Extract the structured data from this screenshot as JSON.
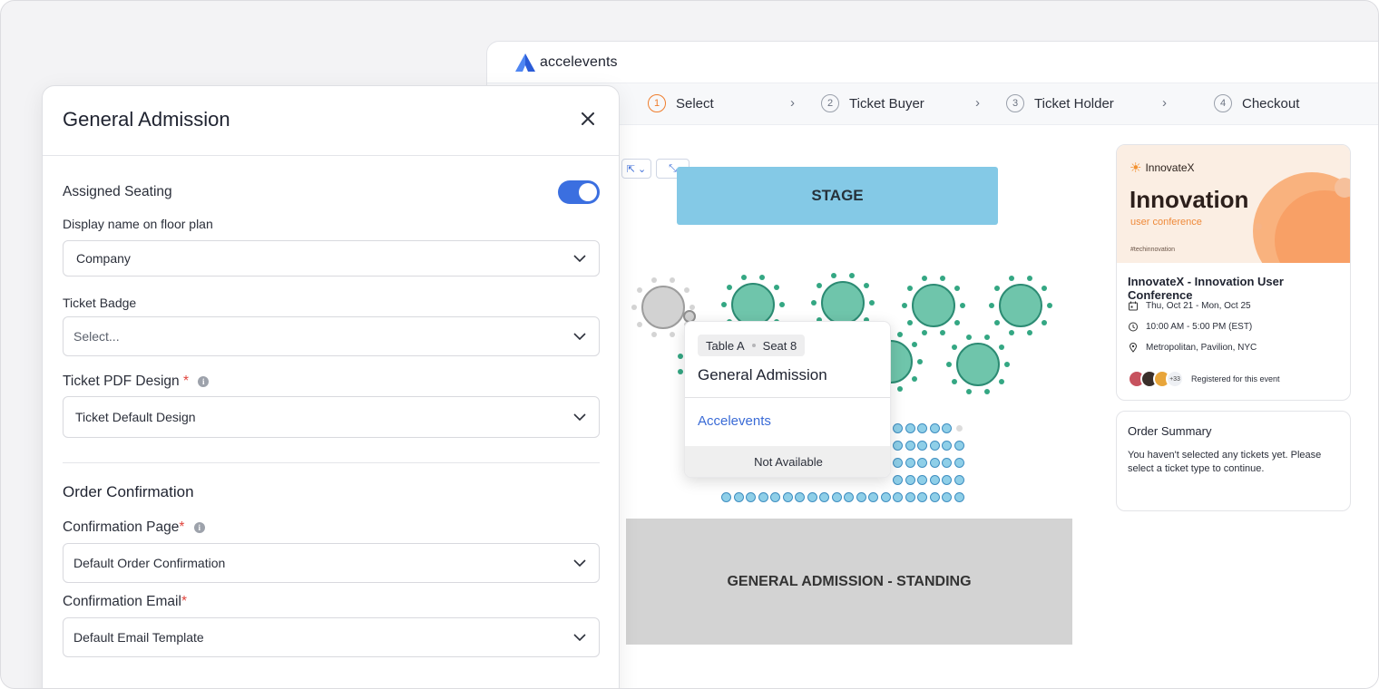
{
  "app": {
    "brand": "accelevents",
    "steps": [
      {
        "num": "1",
        "label": "Select"
      },
      {
        "num": "2",
        "label": "Ticket Buyer"
      },
      {
        "num": "3",
        "label": "Ticket Holder"
      },
      {
        "num": "4",
        "label": "Checkout"
      }
    ],
    "step_arrow": "›"
  },
  "floor_plan": {
    "stage_label": "STAGE",
    "standing_label": "GENERAL ADMISSION - STANDING",
    "tool_select": "⇱ ⌄",
    "tool_expand": "⤡"
  },
  "popup": {
    "table": "Table A",
    "seat": "Seat 8",
    "title": "General Admission",
    "company": "Accelevents",
    "status": "Not Available"
  },
  "event": {
    "brand": "InnovateX",
    "banner_title": "Innovation",
    "banner_subtitle": "user conference",
    "hashtag": "#techinnovation",
    "title": "InnovateX - Innovation User Conference",
    "dates": "Thu, Oct 21 - Mon, Oct 25",
    "time": "10:00 AM - 5:00 PM (EST)",
    "location": "Metropolitan, Pavilion, NYC",
    "more_count": "+33",
    "registered": "Registered for this event",
    "icons": [
      "calendar-icon",
      "clock-icon",
      "location-pin-icon"
    ]
  },
  "summary": {
    "title": "Order Summary",
    "text": "You haven't selected any tickets yet. Please select a ticket type to continue."
  },
  "panel": {
    "title": "General Admission",
    "assigned_seating": "Assigned Seating",
    "assigned_seating_on": true,
    "display_name_label": "Display name on floor plan",
    "display_name_value": "Company",
    "ticket_badge_label": "Ticket Badge",
    "ticket_badge_placeholder": "Select...",
    "pdf_label": "Ticket PDF Design",
    "pdf_value": "Ticket Default Design",
    "order_confirmation": "Order Confirmation",
    "confirmation_page_label": "Confirmation Page",
    "confirmation_page_value": "Default Order Confirmation",
    "confirmation_email_label": "Confirmation Email",
    "confirmation_email_value": "Default Email Template",
    "required_mark": "*",
    "info_mark": "i"
  },
  "colors": {
    "accent": "#3b6fe0",
    "stage": "#84c9e6",
    "table": "#6fc5ab",
    "step_active": "#ef7d2d",
    "required": "#e0453e"
  }
}
